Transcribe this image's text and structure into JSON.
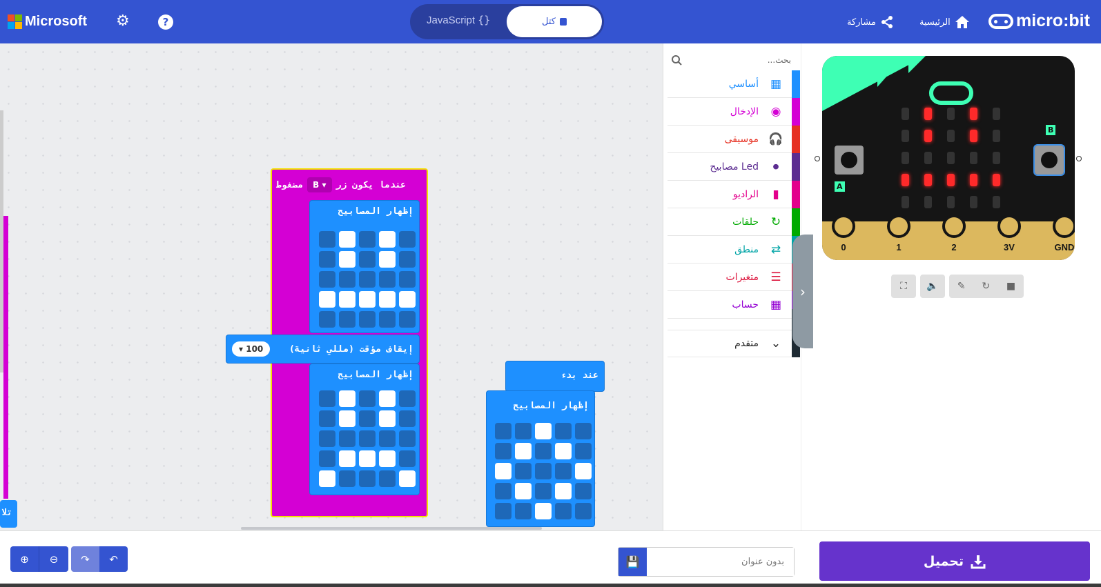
{
  "header": {
    "brand": "Microsoft",
    "settings_icon": "gear-icon",
    "help_icon": "help-icon",
    "toggle": {
      "javascript_label": "JavaScript",
      "blocks_label": "كتل"
    },
    "share_label": "مشاركة",
    "home_label": "الرئيسية",
    "logo": "micro:bit"
  },
  "toolbox": {
    "search_placeholder": "بحث...",
    "categories": [
      {
        "label": "أساسي",
        "color": "#1e90ff",
        "icon": "grid-icon"
      },
      {
        "label": "الإدخال",
        "color": "#d400d4",
        "icon": "target-icon"
      },
      {
        "label": "موسيقى",
        "color": "#e63022",
        "icon": "headphones-icon"
      },
      {
        "label": "مصابيح Led",
        "color": "#5c2d91",
        "icon": "toggle-icon"
      },
      {
        "label": "الراديو",
        "color": "#e3008c",
        "icon": "signal-icon"
      },
      {
        "label": "حلقات",
        "color": "#00aa00",
        "icon": "loop-icon"
      },
      {
        "label": "منطق",
        "color": "#00a4a6",
        "icon": "shuffle-icon"
      },
      {
        "label": "متغيرات",
        "color": "#dc143c",
        "icon": "list-icon"
      },
      {
        "label": "حساب",
        "color": "#9400d3",
        "icon": "calculator-icon"
      }
    ],
    "advanced_label": "متقدم"
  },
  "workspace": {
    "event_block": {
      "label": "عندما يكون زر",
      "button_value": "B",
      "suffix": "مضغوط"
    },
    "show_leds_1": {
      "label": "إظهار المصابيح",
      "leds": [
        0,
        1,
        0,
        1,
        0,
        0,
        1,
        0,
        1,
        0,
        0,
        0,
        0,
        0,
        0,
        1,
        1,
        1,
        1,
        1,
        0,
        0,
        0,
        0,
        0
      ]
    },
    "pause_block": {
      "label": "إيقاف مؤقت (مللي ثانية)",
      "value": "100"
    },
    "show_leds_2": {
      "label": "إظهار المصابيح",
      "leds": [
        0,
        1,
        0,
        1,
        0,
        0,
        1,
        0,
        1,
        0,
        0,
        0,
        0,
        0,
        0,
        0,
        1,
        1,
        1,
        0,
        1,
        0,
        0,
        0,
        1
      ]
    },
    "start_block": {
      "label": "عند بدء"
    },
    "show_leds_3": {
      "label": "إظهار المصابيح",
      "leds": [
        0,
        0,
        1,
        0,
        0,
        0,
        1,
        0,
        1,
        0,
        1,
        0,
        0,
        0,
        1,
        0,
        1,
        0,
        1,
        0,
        0,
        0,
        1,
        0,
        0
      ]
    },
    "offscreen_label": "تلا"
  },
  "simulator": {
    "button_a": "A",
    "button_b": "B",
    "pins": [
      "0",
      "1",
      "2",
      "3V",
      "GND"
    ],
    "display": [
      0,
      1,
      0,
      1,
      0,
      0,
      1,
      0,
      1,
      0,
      0,
      0,
      0,
      0,
      0,
      1,
      1,
      1,
      1,
      1,
      0,
      0,
      0,
      0,
      0
    ],
    "led_on_color": "#ff2a2a",
    "controls": [
      "fullscreen-icon",
      "sound-icon",
      "debug-icon",
      "restart-icon",
      "stop-icon"
    ]
  },
  "footer": {
    "project_name_placeholder": "بدون عنوان",
    "download_label": "تحميل"
  },
  "colors": {
    "header": "#3454d1",
    "event_block": "#d400d4",
    "basic_block": "#1e90ff",
    "download": "#6633cc"
  }
}
